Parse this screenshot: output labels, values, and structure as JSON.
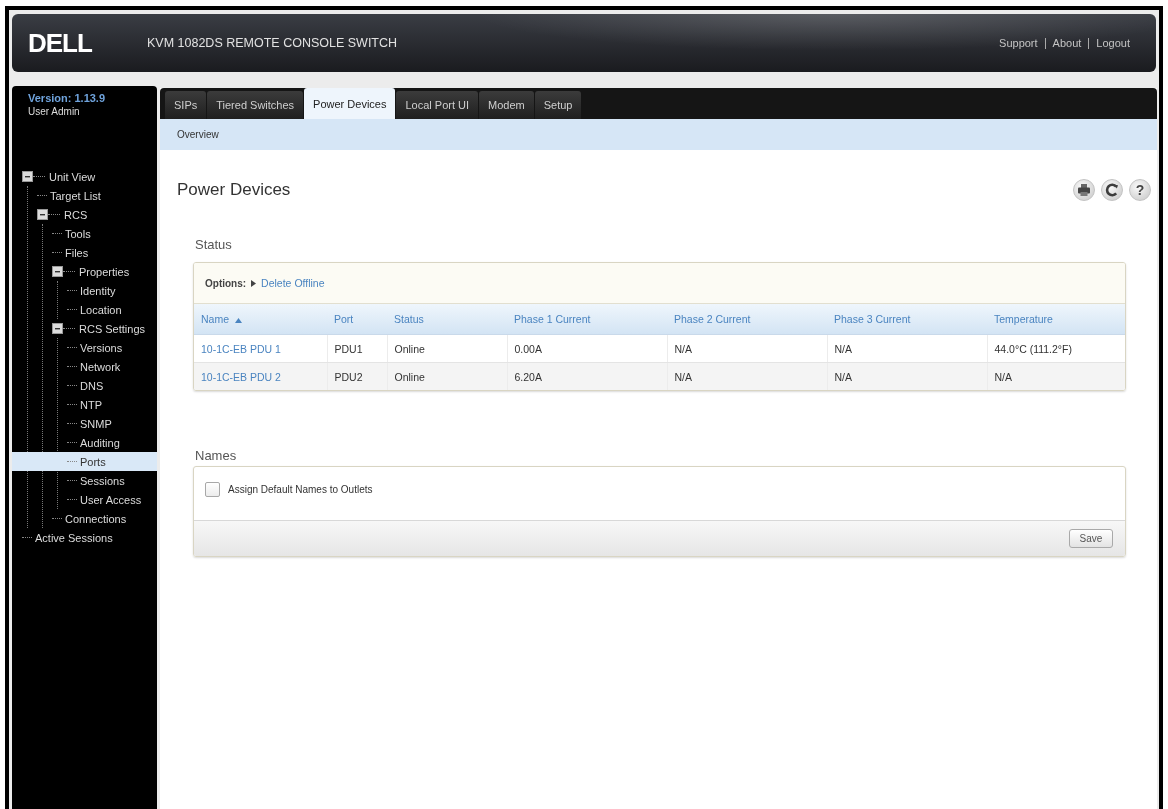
{
  "header": {
    "logo": "DELL",
    "title": "KVM 1082DS REMOTE CONSOLE SWITCH",
    "links": [
      "Support",
      "About",
      "Logout"
    ]
  },
  "sidebar": {
    "version": "Version: 1.13.9",
    "user": "User Admin",
    "tree": [
      {
        "label": "Unit View",
        "selected": false,
        "expanded": true,
        "children": [
          {
            "label": "Target List",
            "selected": false
          },
          {
            "label": "RCS",
            "selected": false,
            "expanded": true,
            "children": [
              {
                "label": "Tools",
                "selected": false
              },
              {
                "label": "Files",
                "selected": false
              },
              {
                "label": "Properties",
                "selected": false,
                "expanded": true,
                "children": [
                  {
                    "label": "Identity",
                    "selected": false
                  },
                  {
                    "label": "Location",
                    "selected": false
                  }
                ]
              },
              {
                "label": "RCS Settings",
                "selected": false,
                "expanded": true,
                "children": [
                  {
                    "label": "Versions",
                    "selected": false
                  },
                  {
                    "label": "Network",
                    "selected": false
                  },
                  {
                    "label": "DNS",
                    "selected": false
                  },
                  {
                    "label": "NTP",
                    "selected": false
                  },
                  {
                    "label": "SNMP",
                    "selected": false
                  },
                  {
                    "label": "Auditing",
                    "selected": false
                  },
                  {
                    "label": "Ports",
                    "selected": true
                  },
                  {
                    "label": "Sessions",
                    "selected": false
                  },
                  {
                    "label": "User Access",
                    "selected": false
                  }
                ]
              },
              {
                "label": "Connections",
                "selected": false
              }
            ]
          }
        ]
      },
      {
        "label": "Active Sessions",
        "selected": false
      }
    ]
  },
  "tabs": [
    {
      "label": "SIPs",
      "selected": false
    },
    {
      "label": "Tiered Switches",
      "selected": false
    },
    {
      "label": "Power Devices",
      "selected": true
    },
    {
      "label": "Local Port UI",
      "selected": false
    },
    {
      "label": "Modem",
      "selected": false
    },
    {
      "label": "Setup",
      "selected": false
    }
  ],
  "subnav": [
    "Overview"
  ],
  "page": {
    "title": "Power Devices",
    "help": "?"
  },
  "status": {
    "title": "Status",
    "options_label": "Options:",
    "options": [
      "Delete Offline"
    ],
    "columns": [
      {
        "label": "Name",
        "sorted": true
      },
      {
        "label": "Port",
        "sorted": false
      },
      {
        "label": "Status",
        "sorted": false
      },
      {
        "label": "Phase 1 Current",
        "sorted": false
      },
      {
        "label": "Phase 2 Current",
        "sorted": false
      },
      {
        "label": "Phase 3 Current",
        "sorted": false
      },
      {
        "label": "Temperature",
        "sorted": false
      }
    ],
    "rows": [
      {
        "cells": [
          "10-1C-EB PDU 1",
          "PDU1",
          "Online",
          "0.00A",
          "N/A",
          "N/A",
          "44.0°C (111.2°F)"
        ]
      },
      {
        "cells": [
          "10-1C-EB PDU 2",
          "PDU2",
          "Online",
          "6.20A",
          "N/A",
          "N/A",
          "N/A"
        ]
      }
    ]
  },
  "names": {
    "title": "Names",
    "checkbox": {
      "label": "Assign Default Names to Outlets",
      "checked": false
    },
    "button": "Save"
  }
}
